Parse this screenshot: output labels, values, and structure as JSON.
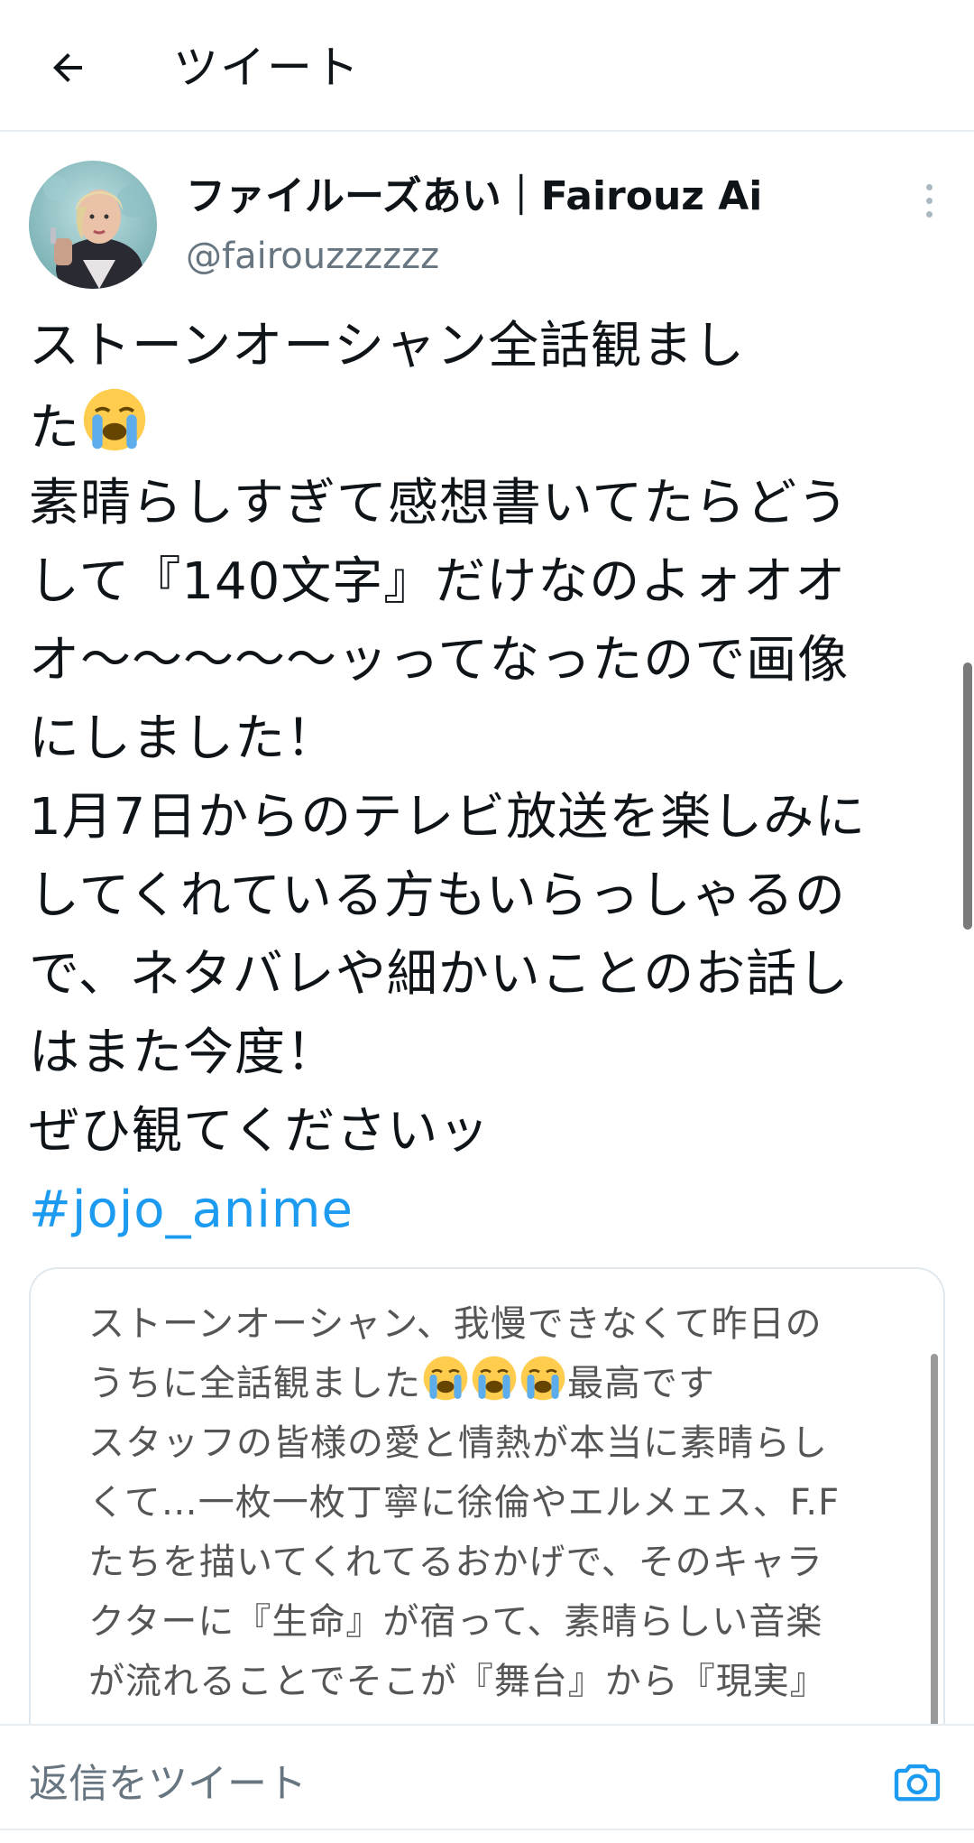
{
  "header": {
    "title": "ツイート",
    "back_icon": "arrow-left-icon"
  },
  "author": {
    "display_name": "ファイルーズあい｜Fairouz Ai",
    "handle": "@fairouzzzzzz",
    "avatar_icon": "profile-photo",
    "more_icon": "more-vertical-icon"
  },
  "tweet": {
    "lines": [
      "ストーンオーシャン全話観まし",
      "た",
      "素晴らしすぎて感想書いてたらどう",
      "して『140文字』だけなのよォオオ",
      "オ〜〜〜〜〜ッってなったので画像",
      "にしました！",
      "1月7日からのテレビ放送を楽しみに",
      "してくれている方もいらっしゃるの",
      "で、ネタバレや細かいことのお話し",
      "はまた今度！",
      "ぜひ観てくださいッ"
    ],
    "emoji": "loudly-crying-face",
    "hashtag": "#jojo_anime"
  },
  "image_card": {
    "lines": [
      "ストーンオーシャン、我慢できなくて昨日の",
      "うちに全話観ました",
      "最高です",
      "スタッフの皆様の愛と情熱が本当に素晴らし",
      "くて…一枚一枚丁寧に徐倫やエルメェス、F.F",
      "たちを描いてくれてるおかげで、そのキャラ",
      "クターに『生命』が宿って、素晴らしい音楽",
      "が流れることでそこが『舞台』から『現実』"
    ]
  },
  "reply": {
    "placeholder": "返信をツイート",
    "camera_icon": "camera-icon"
  },
  "colors": {
    "accent": "#1d9bf0",
    "text_primary": "#0f1419",
    "text_secondary": "#66757f",
    "divider": "#e6ecf0"
  }
}
